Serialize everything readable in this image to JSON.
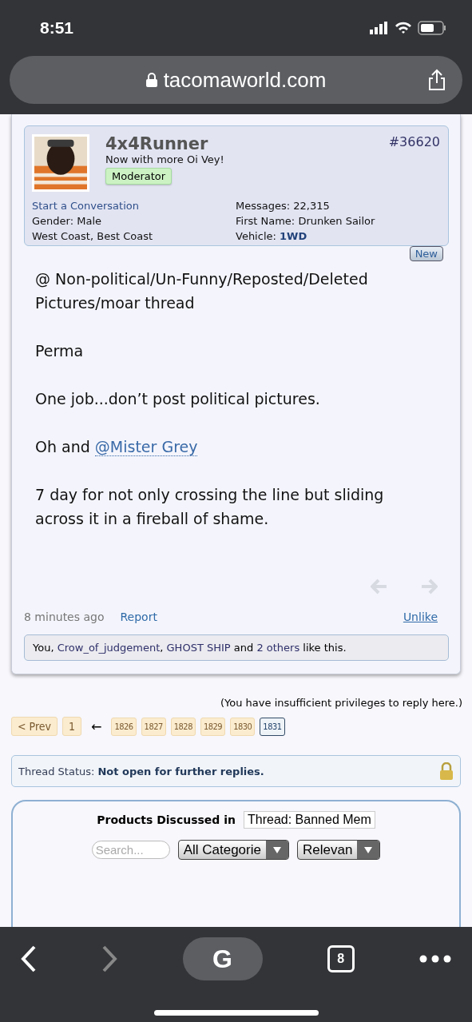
{
  "status_bar": {
    "time": "8:51"
  },
  "address_bar": {
    "url": "tacomaworld.com"
  },
  "post": {
    "author": "4x4Runner",
    "user_title": "Now with more Oi Vey!",
    "badge": "Moderator",
    "number": "#36620",
    "start_conversation": "Start a Conversation",
    "info_left": [
      {
        "label": "Gender:",
        "value": "Male"
      },
      {
        "value": "West Coast, Best Coast"
      }
    ],
    "info_right": [
      {
        "label": "Messages:",
        "value": "22,315",
        "kind": "plain"
      },
      {
        "label": "First Name:",
        "value": "Drunken Sailor",
        "kind": "plain"
      },
      {
        "label": "Vehicle:",
        "value": "1WD",
        "kind": "link"
      }
    ],
    "new_tag": "New",
    "paragraphs": [
      {
        "text": "@ Non-political/Un-Funny/Reposted/Deleted Pictures/moar thread"
      },
      {
        "text": "Perma"
      },
      {
        "text": "One job...don’t post political pictures."
      },
      {
        "text": "Oh and",
        "mention": "@Mister Grey"
      },
      {
        "text": "7 day for not only crossing the line but sliding across it in a fireball of shame."
      }
    ],
    "time": "8 minutes ago",
    "report": "Report",
    "unlike": "Unlike",
    "likes": [
      {
        "text": "You, ",
        "kind": "plain"
      },
      {
        "text": "Crow_of_judgement",
        "kind": "link"
      },
      {
        "text": ", ",
        "kind": "plain"
      },
      {
        "text": "GHOST SHIP",
        "kind": "link"
      },
      {
        "text": " and ",
        "kind": "plain"
      },
      {
        "text": "2 others",
        "kind": "link"
      },
      {
        "text": " like this.",
        "kind": "plain"
      }
    ]
  },
  "reply_notice": "(You have insufficient privileges to reply here.)",
  "pagination": {
    "prev": "< Prev",
    "first": {
      "label": "1",
      "selected": false
    },
    "arrow": "←",
    "pages": [
      {
        "label": "1826",
        "selected": false
      },
      {
        "label": "1827",
        "selected": false
      },
      {
        "label": "1828",
        "selected": false
      },
      {
        "label": "1829",
        "selected": false
      },
      {
        "label": "1830",
        "selected": false
      },
      {
        "label": "1831",
        "selected": true
      }
    ]
  },
  "thread_status": {
    "label": "Thread Status:",
    "value": "Not open for further replies."
  },
  "products": {
    "title": "Products Discussed in",
    "thread_field": "Thread: Banned Mem",
    "search_placeholder": "Search...",
    "category": "All Categorie",
    "sort": "Relevan"
  },
  "toolbar": {
    "search_letter": "G",
    "tabs": "8"
  }
}
